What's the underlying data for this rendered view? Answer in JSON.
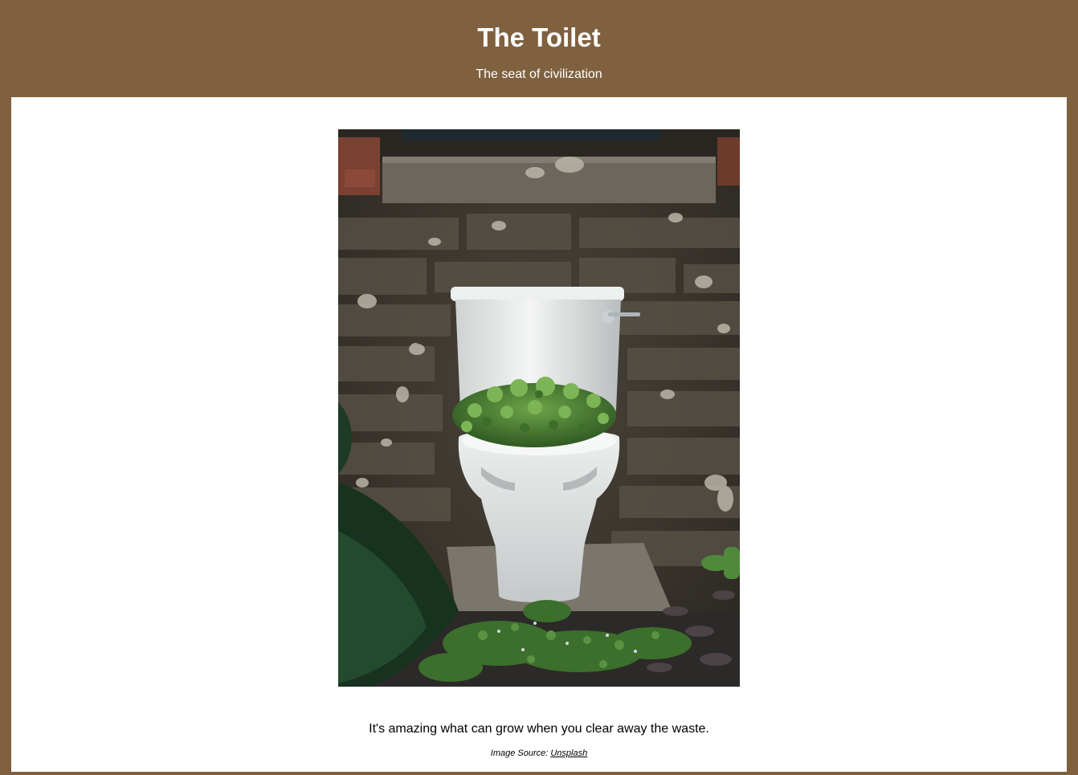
{
  "header": {
    "title": "The Toilet",
    "tagline": "The seat of civilization"
  },
  "main": {
    "photo_alt": "White toilet outdoors against a stone wall with green plants growing out of the bowl",
    "caption": "It's amazing what can grow when you clear away the waste.",
    "credit_prefix": "Image Source: ",
    "credit_link_label": "Unsplash"
  },
  "colors": {
    "page_background": "#7f613f",
    "card_background": "#ffffff",
    "header_text": "#ffffff"
  }
}
